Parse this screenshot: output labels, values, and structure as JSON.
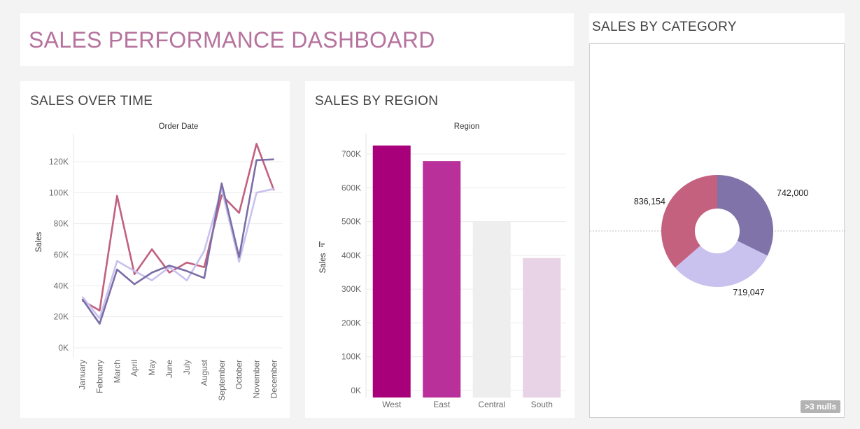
{
  "dashboard": {
    "title": "SALES PERFORMANCE DASHBOARD",
    "nulls_badge": ">3 nulls"
  },
  "panels": {
    "time_title": "SALES OVER TIME",
    "region_title": "SALES BY REGION",
    "category_title": "SALES BY CATEGORY"
  },
  "chart_data": [
    {
      "type": "line",
      "title": "SALES OVER TIME",
      "header": "Order Date",
      "ylabel": "Sales",
      "ylim": [
        0,
        130000
      ],
      "ytick_values": [
        0,
        20000,
        40000,
        60000,
        80000,
        100000,
        120000
      ],
      "ytick_labels": [
        "0K",
        "20K",
        "40K",
        "60K",
        "80K",
        "100K",
        "120K"
      ],
      "x": [
        "January",
        "February",
        "March",
        "April",
        "May",
        "June",
        "July",
        "August",
        "September",
        "October",
        "November",
        "December"
      ],
      "series": [
        {
          "color": "#c2607f",
          "values": [
            30500,
            24000,
            98000,
            47500,
            63500,
            48500,
            55000,
            52000,
            98500,
            87000,
            131500,
            101500
          ]
        },
        {
          "color": "#c9c1ee",
          "values": [
            33000,
            19000,
            56000,
            49500,
            43500,
            52000,
            43500,
            62500,
            102500,
            55500,
            100000,
            102500
          ]
        },
        {
          "color": "#7b6da6",
          "values": [
            31500,
            15500,
            50500,
            41000,
            48500,
            53000,
            49500,
            45000,
            106000,
            58500,
            121000,
            121500
          ]
        }
      ],
      "grid": true,
      "legend": "none"
    },
    {
      "type": "bar",
      "title": "SALES BY REGION",
      "header": "Region",
      "ylabel": "Sales",
      "ylim": [
        0,
        760000
      ],
      "ytick_values": [
        0,
        100000,
        200000,
        300000,
        400000,
        500000,
        600000,
        700000
      ],
      "ytick_labels": [
        "0K",
        "100K",
        "200K",
        "300K",
        "400K",
        "500K",
        "600K",
        "700K"
      ],
      "categories": [
        "West",
        "East",
        "Central",
        "South"
      ],
      "values": [
        725000,
        679000,
        501000,
        392000
      ],
      "colors": [
        "#a8007a",
        "#b9309a",
        "#eeeeee",
        "#e8d2e5"
      ],
      "grid": true,
      "sort_icon": "sort-descending-icon"
    },
    {
      "type": "pie",
      "title": "SALES BY CATEGORY",
      "donut": true,
      "values": [
        742000,
        719047,
        836154
      ],
      "labels": [
        "742,000",
        "719,047",
        "836,154"
      ],
      "colors": [
        "#8073a9",
        "#c9c1ee",
        "#c4617f"
      ]
    }
  ]
}
